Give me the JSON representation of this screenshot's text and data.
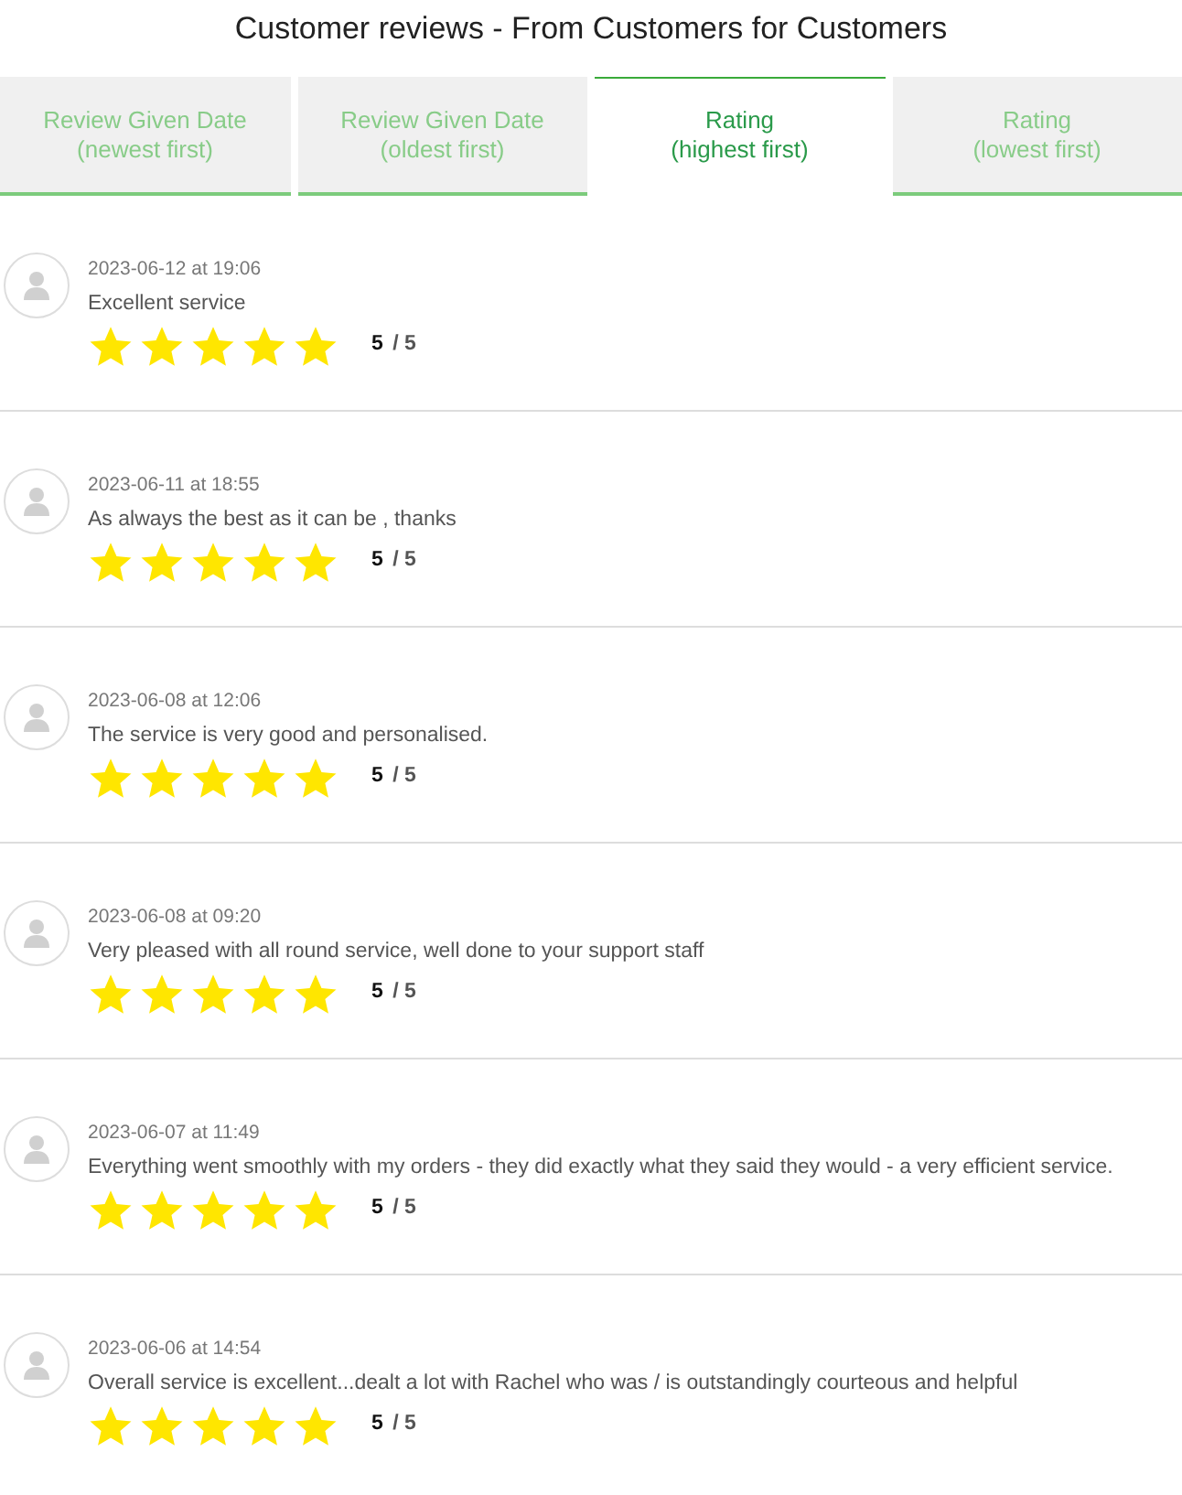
{
  "title": "Customer reviews - From Customers for Customers",
  "tabs": [
    {
      "label": "Review Given Date",
      "sublabel": "(newest first)",
      "selected": false
    },
    {
      "label": "Review Given Date",
      "sublabel": "(oldest first)",
      "selected": false
    },
    {
      "label": "Rating",
      "sublabel": "(highest first)",
      "selected": true
    },
    {
      "label": "Rating",
      "sublabel": "(lowest first)",
      "selected": false
    }
  ],
  "reviews": [
    {
      "date": "2023-06-12 at 19:06",
      "text": "Excellent service",
      "stars": 5,
      "score": "**5** / 5"
    },
    {
      "date": "2023-06-11 at 18:55",
      "text": "As always the best as it can be , thanks",
      "stars": 5,
      "score": "**5** / 5"
    },
    {
      "date": "2023-06-08 at 12:06",
      "text": "The service is very good and personalised.",
      "stars": 5,
      "score": "**5** / 5"
    },
    {
      "date": "2023-06-08 at 09:20",
      "text": "Very pleased with all round service, well done to your support staff",
      "stars": 5,
      "score": "**5** / 5"
    },
    {
      "date": "2023-06-07 at 11:49",
      "text": "Everything went smoothly with my orders - they did exactly what they said they would - a very efficient service.",
      "stars": 5,
      "score": "**5** / 5"
    },
    {
      "date": "2023-06-06 at 14:54",
      "text": "Overall service is excellent...dealt a lot with Rachel who was / is outstandingly courteous and helpful",
      "stars": 5,
      "score": "**5** / 5"
    }
  ]
}
